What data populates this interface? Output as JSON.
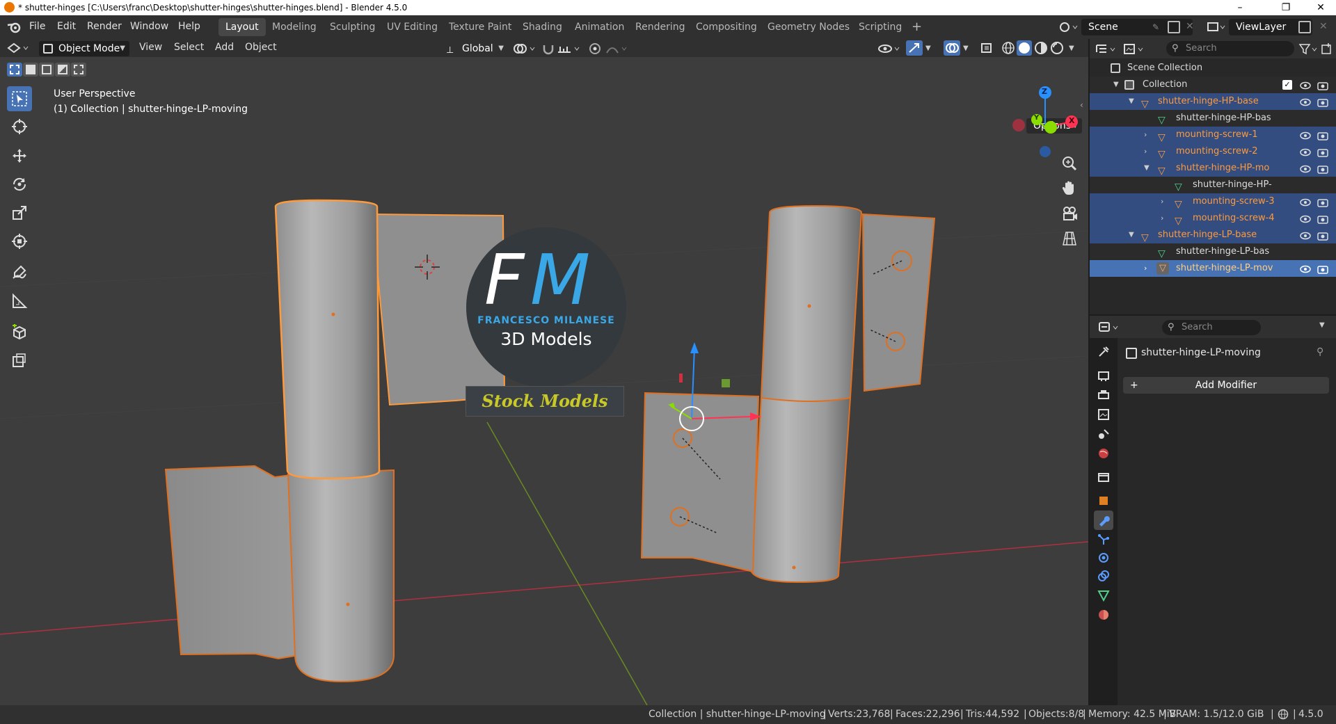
{
  "window": {
    "title": "* shutter-hinges [C:\\Users\\franc\\Desktop\\shutter-hinges\\shutter-hinges.blend] - Blender 4.5.0",
    "minimize": "–",
    "maximize": "❐",
    "close": "✕"
  },
  "menu": [
    "File",
    "Edit",
    "Render",
    "Window",
    "Help"
  ],
  "workspaces": [
    "Layout",
    "Modeling",
    "Sculpting",
    "UV Editing",
    "Texture Paint",
    "Shading",
    "Animation",
    "Rendering",
    "Compositing",
    "Geometry Nodes",
    "Scripting"
  ],
  "active_workspace": "Layout",
  "workspace_add": "+",
  "scene": "Scene",
  "view_layer": "ViewLayer",
  "viewport_header": {
    "mode": "Object Mode",
    "menus": [
      "View",
      "Select",
      "Add",
      "Object"
    ],
    "orientation": "Global",
    "options": "Options"
  },
  "viewport": {
    "perspective": "User Perspective",
    "collection_info": "(1) Collection | shutter-hinge-LP-moving",
    "gizmo_axes": [
      "Z",
      "Y",
      "X"
    ],
    "watermark": {
      "initials_f": "F",
      "initials_m": "M",
      "brand": "FRANCESCO MILANESE",
      "subtitle": "3D Models",
      "banner": "Stock Models"
    }
  },
  "outliner": {
    "search_placeholder": "Search",
    "rows": [
      {
        "label": "Scene Collection"
      },
      {
        "label": "Collection"
      },
      {
        "label": "shutter-hinge-HP-base"
      },
      {
        "label": "shutter-hinge-HP-bas"
      },
      {
        "label": "mounting-screw-1"
      },
      {
        "label": "mounting-screw-2"
      },
      {
        "label": "shutter-hinge-HP-mo"
      },
      {
        "label": "shutter-hinge-HP-"
      },
      {
        "label": "mounting-screw-3"
      },
      {
        "label": "mounting-screw-4"
      },
      {
        "label": "shutter-hinge-LP-base"
      },
      {
        "label": "shutter-hinge-LP-bas"
      },
      {
        "label": "shutter-hinge-LP-mov"
      }
    ]
  },
  "properties": {
    "search_placeholder": "Search",
    "object_name": "shutter-hinge-LP-moving",
    "add_modifier": "Add Modifier",
    "add_icon": "+"
  },
  "statusbar": {
    "collection": "Collection | shutter-hinge-LP-moving",
    "verts": "Verts:23,768",
    "faces": "Faces:22,296",
    "tris": "Tris:44,592",
    "objects": "Objects:8/8",
    "memory": "Memory: 42.5 MiB",
    "vram": "VRAM: 1.5/12.0 GiB",
    "version": "4.5.0"
  },
  "colors": {
    "accent": "#4772b3",
    "selection_orange": "#ff8a2a",
    "active_orange": "#ffb060",
    "x_axis": "#ff3352",
    "y_axis": "#8bdc00",
    "z_axis": "#2890ff",
    "viewport_bg": "#3d3d3d"
  }
}
